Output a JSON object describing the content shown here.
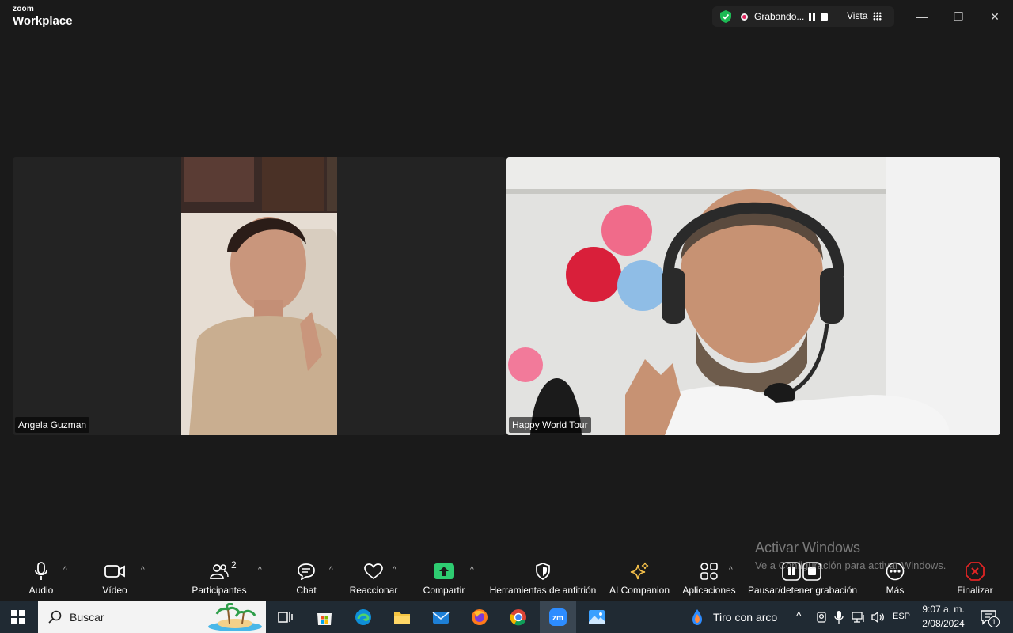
{
  "titlebar": {
    "logo_top": "zoom",
    "logo_bottom": "Workplace",
    "recording_label": "Grabando...",
    "view_label": "Vista",
    "minimize": "—",
    "maximize": "❐",
    "close": "✕"
  },
  "participants": [
    {
      "name": "Angela Guzman"
    },
    {
      "name": "Happy World Tour"
    }
  ],
  "toolbar": {
    "audio": "Audio",
    "video": "Vídeo",
    "participants": "Participantes",
    "participants_count": "2",
    "chat": "Chat",
    "react": "Reaccionar",
    "share": "Compartir",
    "host_tools": "Herramientas de anfitrión",
    "ai_companion": "AI Companion",
    "apps": "Aplicaciones",
    "pause_recording": "Pausar/detener grabación",
    "more": "Más",
    "end": "Finalizar"
  },
  "watermark": {
    "line1": "Activar Windows",
    "line2": "Ve a Configuración para activar Windows."
  },
  "taskbar": {
    "search_placeholder": "Buscar",
    "weather_label": "Tiro con arco",
    "language": "ESP",
    "time": "9:07 a. m.",
    "date": "2/08/2024",
    "notifications": "1"
  },
  "colors": {
    "share_green": "#2ecc71",
    "record_red": "#e0245e",
    "end_red": "#e02424",
    "shield_green": "#1db954"
  }
}
